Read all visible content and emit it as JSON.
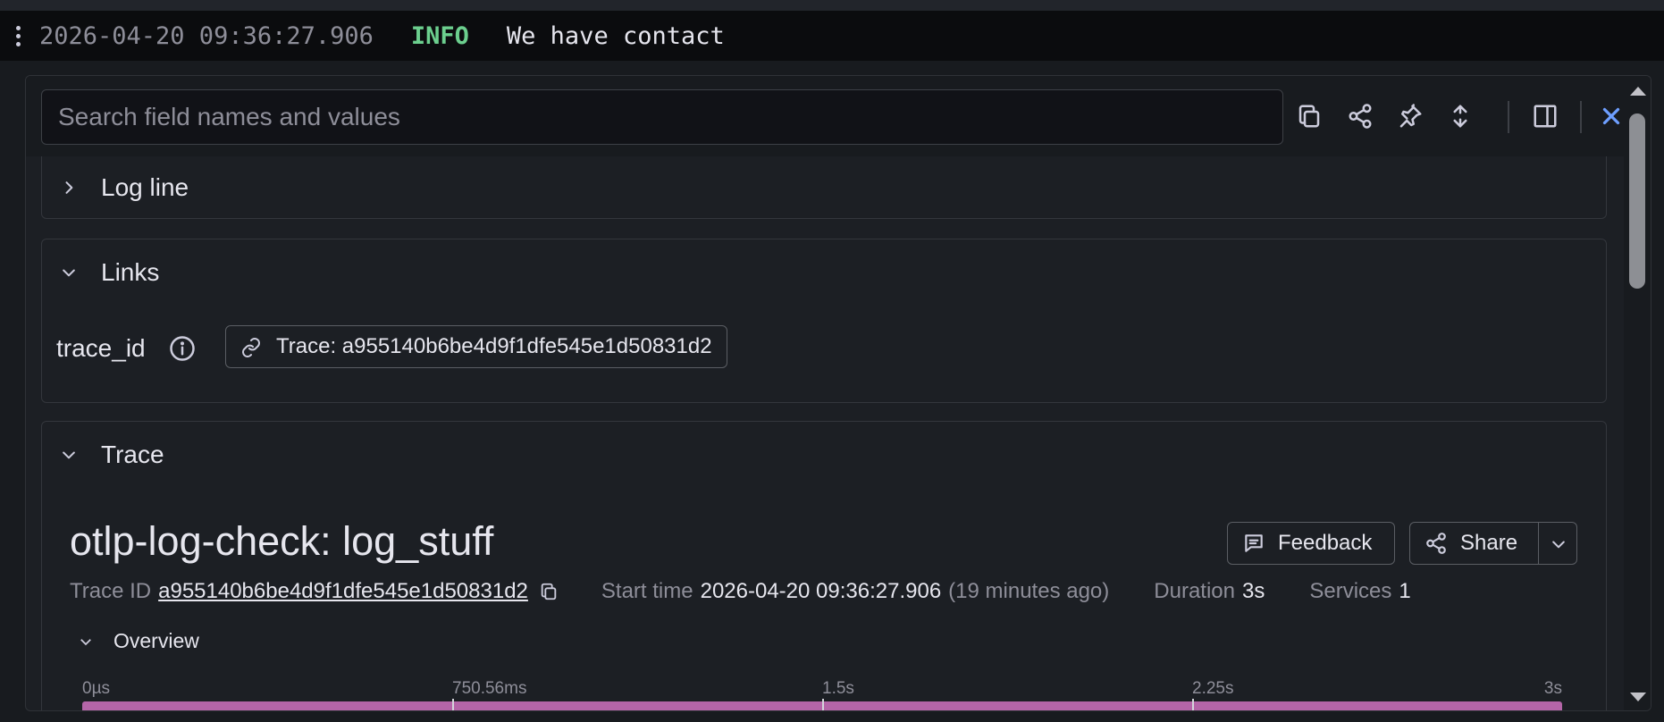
{
  "log_row": {
    "timestamp": "2026-04-20 09:36:27.906",
    "level": "INFO",
    "message": "We have contact"
  },
  "toolbar": {
    "search_placeholder": "Search field names and values",
    "icons": [
      "copy-icon",
      "share-icon",
      "pin-icon",
      "expand-collapse-icon",
      "sidebar-toggle-icon",
      "close-icon"
    ]
  },
  "sections": {
    "log_line": {
      "title": "Log line"
    },
    "links": {
      "title": "Links",
      "field_name": "trace_id",
      "link_label": "Trace: a955140b6be4d9f1dfe545e1d50831d2"
    },
    "trace": {
      "title": "Trace",
      "name": "otlp-log-check: log_stuff",
      "feedback_label": "Feedback",
      "share_label": "Share",
      "trace_id_key": "Trace ID",
      "trace_id": "a955140b6be4d9f1dfe545e1d50831d2",
      "start_time_key": "Start time",
      "start_time": "2026-04-20 09:36:27.906",
      "start_time_ago": "(19 minutes ago)",
      "duration_key": "Duration",
      "duration": "3s",
      "services_key": "Services",
      "services": "1",
      "overview_label": "Overview",
      "ticks": [
        "0µs",
        "750.56ms",
        "1.5s",
        "2.25s",
        "3s"
      ]
    }
  },
  "colors": {
    "info_level": "#6ccf8e",
    "timeline_bar": "#b465a8",
    "close_accent": "#6e9fff"
  }
}
